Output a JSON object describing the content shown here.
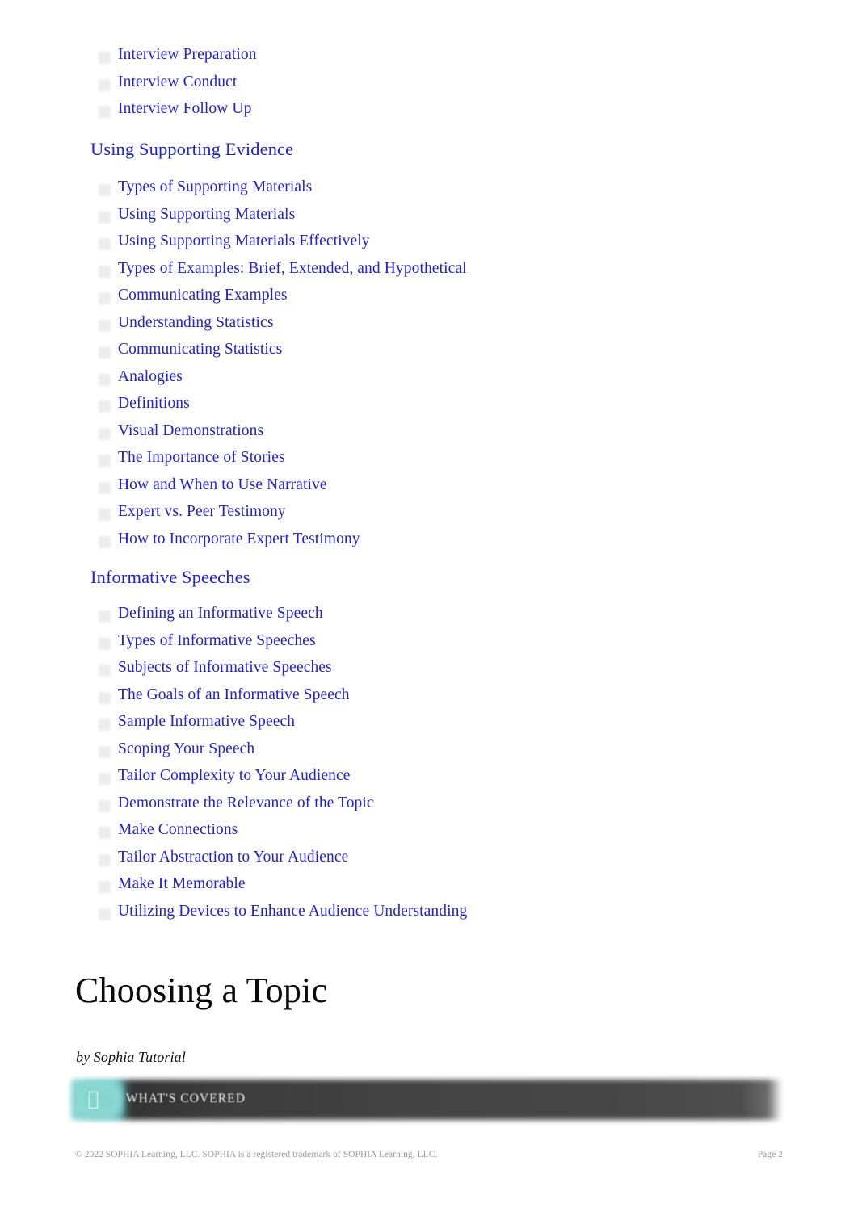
{
  "document": {
    "title": "Choosing a Topic",
    "byline": "by Sophia Tutorial"
  },
  "colors": {
    "link": "#2020d6",
    "heading": "#2020d6",
    "banner_accent": "#7fd3ce",
    "banner_bar": "#3f3f3f",
    "footer_text": "#9a9a9a",
    "body_text": "#0a0a0a"
  },
  "toc": {
    "groups": [
      {
        "heading": null,
        "items": [
          {
            "label": "Interview Preparation"
          },
          {
            "label": "Interview Conduct"
          },
          {
            "label": "Interview Follow Up"
          }
        ]
      },
      {
        "heading": "Using Supporting Evidence",
        "items": [
          {
            "label": "Types of Supporting Materials"
          },
          {
            "label": "Using Supporting Materials"
          },
          {
            "label": "Using Supporting Materials Effectively"
          },
          {
            "label": "Types of Examples: Brief, Extended, and Hypothetical"
          },
          {
            "label": "Communicating Examples"
          },
          {
            "label": "Understanding Statistics"
          },
          {
            "label": "Communicating Statistics"
          },
          {
            "label": "Analogies"
          },
          {
            "label": "Definitions"
          },
          {
            "label": "Visual Demonstrations"
          },
          {
            "label": "The Importance of Stories"
          },
          {
            "label": "How and When to Use Narrative"
          },
          {
            "label": "Expert vs. Peer Testimony"
          },
          {
            "label": "How to Incorporate Expert Testimony"
          }
        ]
      },
      {
        "heading": "Informative Speeches",
        "items": [
          {
            "label": "Defining an Informative Speech"
          },
          {
            "label": "Types of Informative Speeches"
          },
          {
            "label": "Subjects of Informative Speeches"
          },
          {
            "label": "The Goals of an Informative Speech"
          },
          {
            "label": "Sample Informative Speech"
          },
          {
            "label": "Scoping Your Speech"
          },
          {
            "label": "Tailor Complexity to Your Audience"
          },
          {
            "label": "Demonstrate the Relevance of the Topic"
          },
          {
            "label": "Make Connections"
          },
          {
            "label": "Tailor Abstraction to Your Audience"
          },
          {
            "label": "Make It Memorable"
          },
          {
            "label": "Utilizing Devices to Enhance Audience Understanding"
          }
        ]
      }
    ]
  },
  "callout": {
    "label": "WHAT'S COVERED",
    "icon": "book-icon"
  },
  "footer": {
    "copyright": "© 2022 SOPHIA Learning, LLC. SOPHIA is a registered trademark of SOPHIA Learning, LLC.",
    "page": "Page 2"
  }
}
